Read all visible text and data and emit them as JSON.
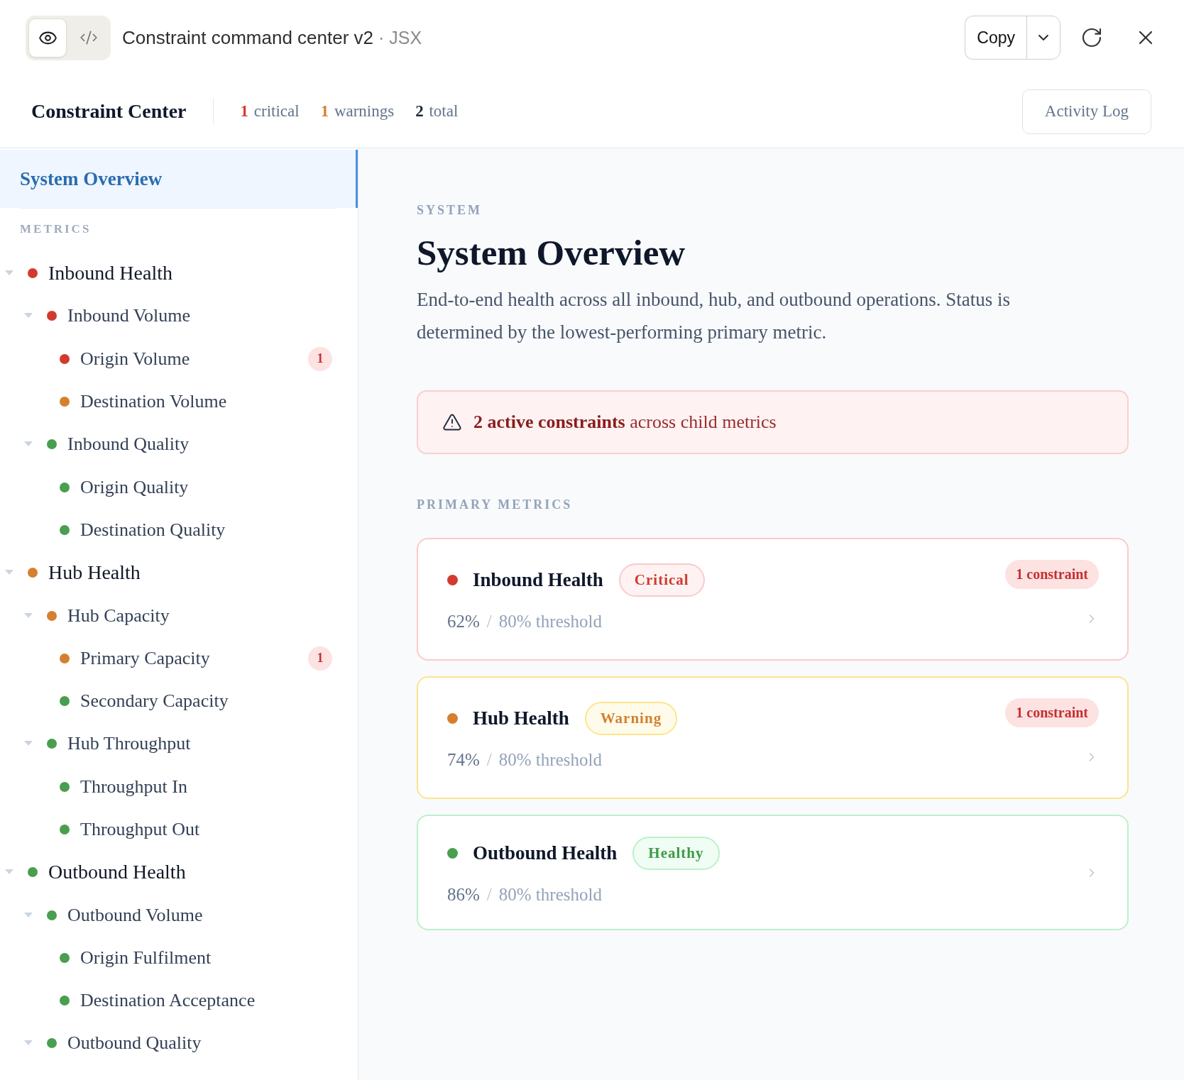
{
  "toolbar": {
    "view_toggle": [
      {
        "kind": "preview",
        "selected": true
      },
      {
        "kind": "code",
        "selected": false
      }
    ],
    "title": "Constraint command center v2",
    "subtitle": "· JSX",
    "copy_label": "Copy"
  },
  "header": {
    "title": "Constraint Center",
    "counts": [
      {
        "text": "**1** critical",
        "color": "#d33a2f"
      },
      {
        "text": "**1** warnings",
        "color": "#d4802f"
      },
      {
        "text": "**2** total",
        "color": "#1e293b"
      }
    ],
    "activity_button": "Activity Log"
  },
  "sidebar": {
    "overview": {
      "label": "System Overview",
      "selected": true
    },
    "section_label": "METRICS",
    "tree": [
      {
        "label": "Inbound Health",
        "color": "#d33a2f",
        "selected": false,
        "expanded": true,
        "children": [
          {
            "label": "Inbound Volume",
            "color": "#d33a2f",
            "selected": false,
            "expanded": true,
            "children": [
              {
                "label": "Origin Volume",
                "color": "#d33a2f",
                "selected": false,
                "badge": "1"
              },
              {
                "label": "Destination Volume",
                "color": "#d4802f",
                "selected": false
              }
            ]
          },
          {
            "label": "Inbound Quality",
            "color": "#4a9e4f",
            "selected": false,
            "expanded": true,
            "children": [
              {
                "label": "Origin Quality",
                "color": "#4a9e4f",
                "selected": false
              },
              {
                "label": "Destination Quality",
                "color": "#4a9e4f",
                "selected": false
              }
            ]
          }
        ]
      },
      {
        "label": "Hub Health",
        "color": "#d4802f",
        "selected": false,
        "expanded": true,
        "children": [
          {
            "label": "Hub Capacity",
            "color": "#d4802f",
            "selected": false,
            "expanded": true,
            "children": [
              {
                "label": "Primary Capacity",
                "color": "#d4802f",
                "selected": false,
                "badge": "1"
              },
              {
                "label": "Secondary Capacity",
                "color": "#4a9e4f",
                "selected": false
              }
            ]
          },
          {
            "label": "Hub Throughput",
            "color": "#4a9e4f",
            "selected": false,
            "expanded": true,
            "children": [
              {
                "label": "Throughput In",
                "color": "#4a9e4f",
                "selected": false
              },
              {
                "label": "Throughput Out",
                "color": "#4a9e4f",
                "selected": false
              }
            ]
          }
        ]
      },
      {
        "label": "Outbound Health",
        "color": "#4a9e4f",
        "selected": false,
        "expanded": true,
        "children": [
          {
            "label": "Outbound Volume",
            "color": "#4a9e4f",
            "selected": false,
            "expanded": true,
            "children": [
              {
                "label": "Origin Fulfilment",
                "color": "#4a9e4f",
                "selected": false
              },
              {
                "label": "Destination Acceptance",
                "color": "#4a9e4f",
                "selected": false
              }
            ]
          },
          {
            "label": "Outbound Quality",
            "color": "#4a9e4f",
            "selected": false,
            "expanded": true
          }
        ]
      }
    ]
  },
  "main": {
    "eyebrow": "SYSTEM",
    "title": "System Overview",
    "description": "End-to-end health across all inbound, hub, and outbound operations. Status is determined by the lowest-performing primary metric.",
    "alert": "**2 active constraints** across child metrics",
    "section_label": "PRIMARY METRICS",
    "metrics": [
      {
        "name": "Inbound Health",
        "color": "#d33a2f",
        "status": {
          "kind": "critical",
          "label": "Critical"
        },
        "constraints": "1 constraint",
        "value": "62%",
        "separator": "/",
        "threshold": "80% threshold"
      },
      {
        "name": "Hub Health",
        "color": "#d4802f",
        "status": {
          "kind": "warning",
          "label": "Warning"
        },
        "constraints": "1 constraint",
        "value": "74%",
        "separator": "/",
        "threshold": "80% threshold"
      },
      {
        "name": "Outbound Health",
        "color": "#4a9e4f",
        "status": {
          "kind": "healthy",
          "label": "Healthy"
        },
        "value": "86%",
        "separator": "/",
        "threshold": "80% threshold"
      }
    ]
  }
}
